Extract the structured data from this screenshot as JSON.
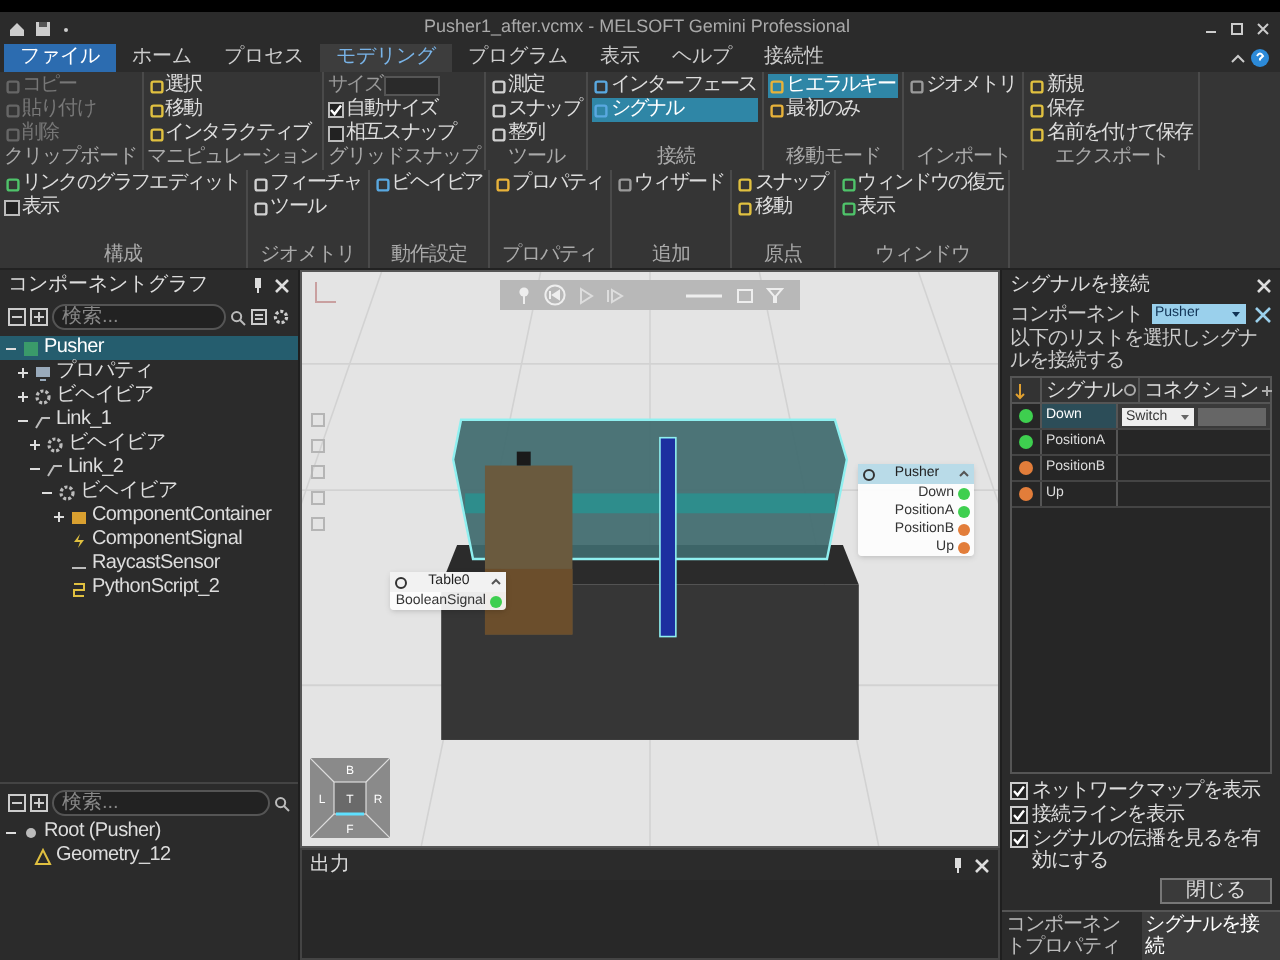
{
  "window": {
    "title": "Pusher1_after.vcmx - MELSOFT Gemini Professional"
  },
  "file_menu": {
    "label": "ファイル"
  },
  "menu_tabs": [
    {
      "label": "ホーム",
      "kind": "tab",
      "selected": false
    },
    {
      "label": "プロセス",
      "kind": "tab",
      "selected": false
    },
    {
      "label": "モデリング",
      "kind": "tab",
      "selected": true
    },
    {
      "label": "プログラム",
      "kind": "tab",
      "selected": false
    },
    {
      "label": "表示",
      "kind": "tab",
      "selected": false
    },
    {
      "label": "ヘルプ",
      "kind": "tab",
      "selected": false
    },
    {
      "label": "接続性",
      "kind": "tab",
      "selected": false
    }
  ],
  "ribbon": [
    {
      "label": "クリップボード",
      "items": [
        {
          "kind": "button",
          "label": "コピー",
          "disabled": true
        },
        {
          "kind": "button",
          "label": "貼り付け",
          "disabled": true
        },
        {
          "kind": "button",
          "label": "削除",
          "disabled": true
        }
      ]
    },
    {
      "label": "マニピュレーション",
      "items": [
        {
          "kind": "button",
          "label": "選択"
        },
        {
          "kind": "button",
          "label": "移動"
        },
        {
          "kind": "button",
          "label": "インタラクティブ"
        }
      ]
    },
    {
      "label": "グリッドスナップ",
      "items": [
        {
          "kind": "field",
          "label": "サイズ"
        },
        {
          "kind": "checkbox",
          "label": "自動サイズ",
          "checked": true
        },
        {
          "kind": "checkbox",
          "label": "相互スナップ",
          "checked": false
        }
      ]
    },
    {
      "label": "ツール",
      "items": [
        {
          "kind": "button",
          "label": "測定"
        },
        {
          "kind": "button",
          "label": "スナップ"
        },
        {
          "kind": "button",
          "label": "整列"
        }
      ]
    },
    {
      "label": "接続",
      "items": [
        {
          "kind": "button",
          "label": "インターフェース",
          "selected": false
        },
        {
          "kind": "button",
          "label": "シグナル",
          "selected": true
        }
      ]
    },
    {
      "label": "移動モード",
      "items": [
        {
          "kind": "button",
          "label": "ヒエラルキー",
          "selected": true
        },
        {
          "kind": "button",
          "label": "最初のみ",
          "selected": false
        }
      ]
    },
    {
      "label": "インポート",
      "items": [
        {
          "kind": "button",
          "label": "ジオメトリ"
        }
      ]
    },
    {
      "label": "エクスポート",
      "items": [
        {
          "kind": "button",
          "label": "新規"
        },
        {
          "kind": "button",
          "label": "保存"
        },
        {
          "kind": "button",
          "label": "名前を付けて保存"
        }
      ]
    },
    {
      "label": "構成",
      "items": [
        {
          "kind": "button",
          "label": "リンクのグラフエディット"
        },
        {
          "kind": "checkbox",
          "label": "表示",
          "checked": false
        }
      ]
    },
    {
      "label": "ジオメトリ",
      "items": [
        {
          "kind": "button",
          "label": "フィーチャ"
        },
        {
          "kind": "button",
          "label": "ツール"
        }
      ]
    },
    {
      "label": "動作設定",
      "items": [
        {
          "kind": "button",
          "label": "ビヘイビア"
        }
      ]
    },
    {
      "label": "プロパティ",
      "items": [
        {
          "kind": "button",
          "label": "プロパティ"
        }
      ]
    },
    {
      "label": "追加",
      "items": [
        {
          "kind": "button",
          "label": "ウィザード"
        }
      ]
    },
    {
      "label": "原点",
      "items": [
        {
          "kind": "button",
          "label": "スナップ"
        },
        {
          "kind": "button",
          "label": "移動"
        }
      ]
    },
    {
      "label": "ウィンドウ",
      "items": [
        {
          "kind": "button",
          "label": "ウィンドウの復元"
        },
        {
          "kind": "button",
          "label": "表示"
        }
      ]
    }
  ],
  "component_graph": {
    "title": "コンポーネントグラフ",
    "search": {
      "placeholder": "検索..."
    },
    "tree": [
      {
        "label": "Pusher",
        "kind": "component",
        "expanded": true,
        "selected": true,
        "children": [
          {
            "label": "プロパティ",
            "kind": "properties",
            "expanded": false,
            "selected": false
          },
          {
            "label": "ビヘイビア",
            "kind": "behaviors",
            "expanded": false,
            "selected": false
          },
          {
            "label": "Link_1",
            "kind": "link",
            "expanded": true,
            "selected": false,
            "children": [
              {
                "label": "ビヘイビア",
                "kind": "behaviors",
                "expanded": false,
                "selected": false
              },
              {
                "label": "Link_2",
                "kind": "link",
                "expanded": true,
                "selected": false,
                "children": [
                  {
                    "label": "ビヘイビア",
                    "kind": "behaviors",
                    "expanded": true,
                    "selected": false,
                    "children": [
                      {
                        "label": "ComponentContainer",
                        "kind": "container",
                        "expanded": false,
                        "selected": false
                      },
                      {
                        "label": "ComponentSignal",
                        "kind": "signal",
                        "selected": false
                      },
                      {
                        "label": "RaycastSensor",
                        "kind": "sensor",
                        "selected": false
                      },
                      {
                        "label": "PythonScript_2",
                        "kind": "script",
                        "selected": false
                      }
                    ]
                  }
                ]
              }
            ]
          }
        ]
      }
    ]
  },
  "geometry_tree": {
    "search": {
      "placeholder": "検索..."
    },
    "tree": [
      {
        "label": "Root (Pusher)",
        "kind": "root",
        "expanded": true,
        "selected": false,
        "children": [
          {
            "label": "Geometry_12",
            "kind": "geometry",
            "selected": false
          }
        ]
      }
    ]
  },
  "viewport": {
    "nav_cube": {
      "top": "B",
      "left": "L",
      "center": "T",
      "right": "R",
      "bottom": "F"
    },
    "nodes": [
      {
        "kind": "component",
        "title": "Pusher",
        "signals": [
          {
            "name": "Down",
            "color": "#3ecf4f"
          },
          {
            "name": "PositionA",
            "color": "#3ecf4f"
          },
          {
            "name": "PositionB",
            "color": "#e27d3a"
          },
          {
            "name": "Up",
            "color": "#e27d3a"
          }
        ]
      },
      {
        "kind": "plain",
        "title": "Table0",
        "signals": [
          {
            "name": "BooleanSignal",
            "color": "#3ecf4f"
          }
        ]
      }
    ]
  },
  "output_panel": {
    "title": "出力"
  },
  "signal_panel": {
    "title": "シグナルを接続",
    "component_label": "コンポーネント",
    "component_value": "Pusher",
    "hint": "以下のリストを選択しシグナルを接続する",
    "columns": [
      "シグナル",
      "コネクション"
    ],
    "rows": [
      {
        "name": "Down",
        "color": "#3ecf4f",
        "selected": true,
        "connection": "Switch"
      },
      {
        "name": "PositionA",
        "color": "#3ecf4f",
        "selected": false
      },
      {
        "name": "PositionB",
        "color": "#e27d3a",
        "selected": false
      },
      {
        "name": "Up",
        "color": "#e27d3a",
        "selected": false
      }
    ],
    "options": [
      {
        "label": "ネットワークマップを表示",
        "checked": true
      },
      {
        "label": "接続ラインを表示",
        "checked": true
      },
      {
        "label": "シグナルの伝播を見るを有効にする",
        "checked": true
      }
    ],
    "close_button": "閉じる"
  },
  "bottom_tabs": [
    {
      "label": "コンポーネントプロパティ",
      "selected": false
    },
    {
      "label": "シグナルを接続",
      "selected": true
    }
  ]
}
